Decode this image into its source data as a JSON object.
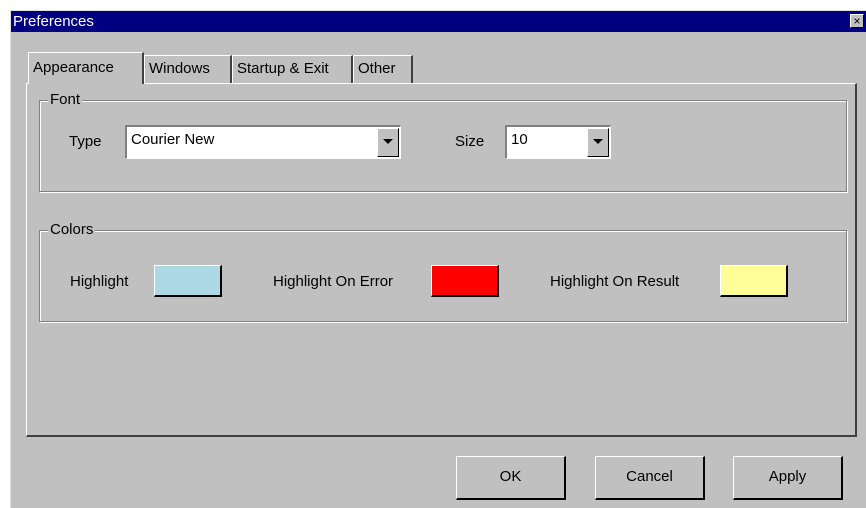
{
  "window": {
    "title": "Preferences",
    "close_glyph": "×",
    "close_icon": "close-icon"
  },
  "tabs": [
    {
      "label": "Appearance",
      "active": true
    },
    {
      "label": "Windows",
      "active": false
    },
    {
      "label": "Startup & Exit",
      "active": false
    },
    {
      "label": "Other",
      "active": false
    }
  ],
  "font_group": {
    "legend": "Font",
    "type_label": "Type",
    "type_value": "Courier New",
    "size_label": "Size",
    "size_value": "10"
  },
  "colors_group": {
    "legend": "Colors",
    "items": [
      {
        "label": "Highlight",
        "color": "#add8e6"
      },
      {
        "label": "Highlight On Error",
        "color": "#ff0000"
      },
      {
        "label": "Highlight On Result",
        "color": "#ffff99"
      }
    ]
  },
  "buttons": {
    "ok": "OK",
    "cancel": "Cancel",
    "apply": "Apply"
  }
}
